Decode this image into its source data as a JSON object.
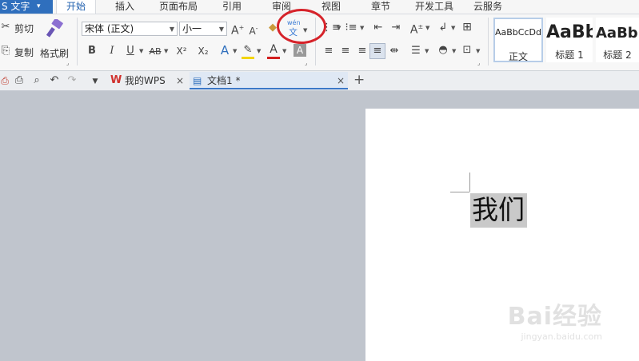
{
  "menubar": {
    "app_label": "S 文字",
    "app_caret": "▾",
    "tabs": [
      "开始",
      "插入",
      "页面布局",
      "引用",
      "审阅",
      "视图",
      "章节",
      "开发工具",
      "云服务"
    ]
  },
  "ribbon": {
    "clipboard": {
      "cut": "剪切",
      "copy": "复制",
      "format_painter": "格式刷"
    },
    "font_name": "宋体 (正文)",
    "font_size": "小一",
    "phonetic_guide_glyph_top": "wén",
    "phonetic_guide_glyph_bottom": "文",
    "bold": "B",
    "italic": "I",
    "underline": "U",
    "strike": "AB",
    "superscript": "X²",
    "subscript": "X₂",
    "styles": [
      {
        "sample": "AaBbCcDd",
        "label": "正文"
      },
      {
        "sample": "AaBb",
        "label": "标题 1"
      },
      {
        "sample": "AaBb",
        "label": "标题 2"
      }
    ]
  },
  "tabbar": {
    "tabs": [
      {
        "label": "我的WPS",
        "close": "×"
      },
      {
        "label": "文档1 *",
        "close": "×"
      }
    ],
    "add": "+"
  },
  "document": {
    "text": "我们"
  },
  "watermark": {
    "brand": "Bai经验",
    "url": "jingyan.baidu.com"
  },
  "colors": {
    "accent": "#2f6fbd",
    "annotation": "#d6232a",
    "font_color": "#d21f1f",
    "highlight": "#f2d400"
  }
}
